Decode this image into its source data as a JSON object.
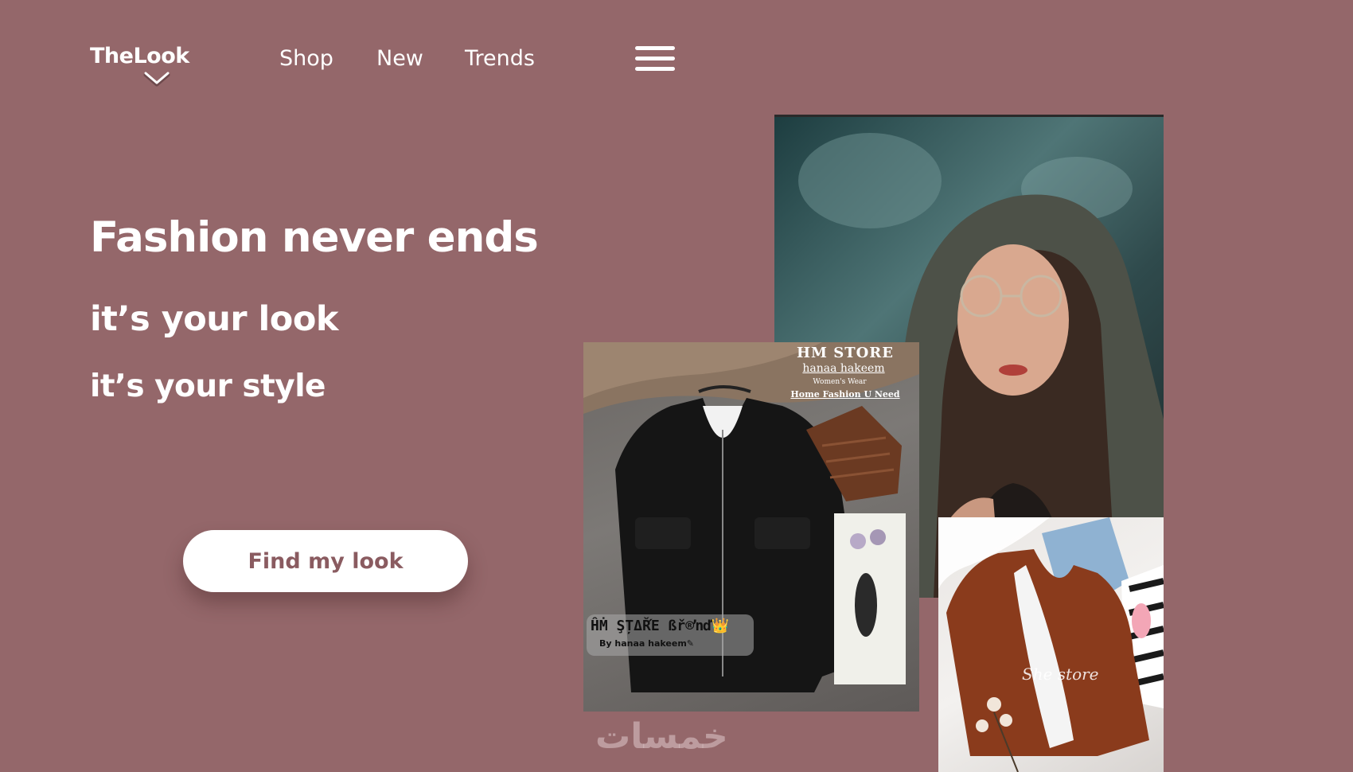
{
  "header": {
    "logo": "TheLook",
    "nav": [
      {
        "label": "Shop"
      },
      {
        "label": "New"
      },
      {
        "label": "Trends"
      }
    ],
    "menu_icon": "hamburger-menu-icon"
  },
  "hero": {
    "headline": "Fashion never ends",
    "subline_1": "it’s your look",
    "subline_2": "it’s your style",
    "cta_label": "Find my look"
  },
  "gallery": {
    "jacket_photo": {
      "store_title": "HM STORE",
      "store_name": "hanaa hakeem",
      "store_subtitle": "Women's Wear",
      "store_tagline": "Home Fashion U Need",
      "badge_brand": "ĤṀ ŞȚΔŘΈ ßř®ŉď👑",
      "badge_by": "By hanaa hakeem✎"
    },
    "outfit_photo": {
      "watermark": "She store"
    }
  },
  "watermark": "خمسات",
  "colors": {
    "background": "#94676a",
    "cta_background": "#ffffff",
    "cta_text": "#8a5b60",
    "text": "#ffffff"
  }
}
